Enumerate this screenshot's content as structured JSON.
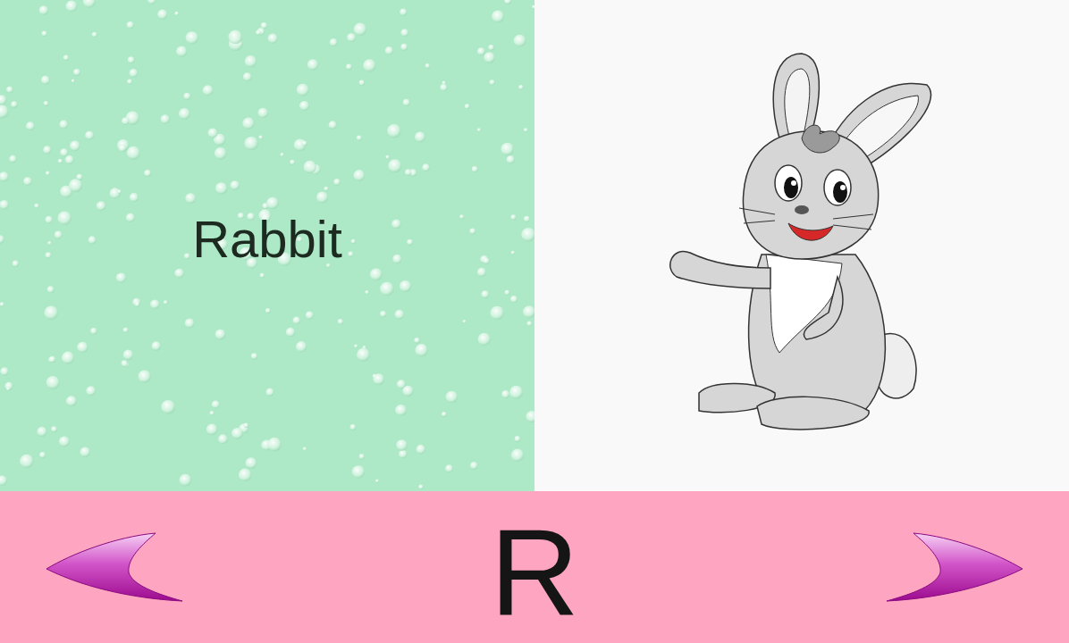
{
  "card": {
    "word": "Rabbit",
    "letter": "R"
  }
}
